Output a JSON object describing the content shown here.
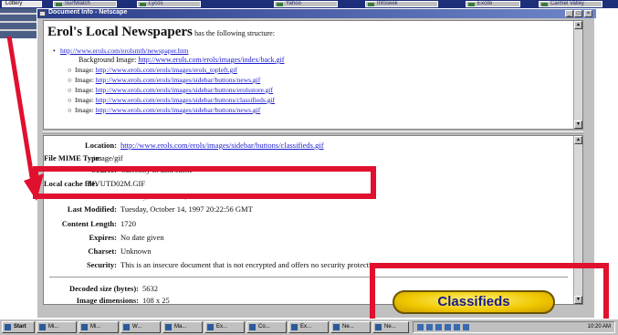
{
  "top_strip": {
    "buttons": [
      "Lottery",
      "SurfWatch",
      "Lycos",
      "Yahoo",
      "Infoseek",
      "Excite",
      "Carmel Valley"
    ]
  },
  "window": {
    "title": "Document Info - Netscape",
    "controls": [
      "_",
      "□",
      "×"
    ]
  },
  "structure": {
    "page_title": "Erol's Local Newspapers",
    "page_subtitle": "has the following structure:",
    "url_line": "http://www.erols.com/erolsmth/newspaper.htm",
    "background_label": "Background Image:",
    "background_url": "http://www.erols.com/erols/images/index/back.gif",
    "image_label": "Image:",
    "image_links": [
      "http://www.erols.com/erols/images/erols_topleft.gif",
      "http://www.erols.com/erols/images/sidebar/buttons/news.gif",
      "http://www.erols.com/erols/images/sidebar/buttons/erolsstore.gif",
      "http://www.erols.com/erols/images/sidebar/buttons/classifieds.gif",
      "http://www.erols.com/erols/images/sidebar/buttons/news.gif"
    ]
  },
  "details": {
    "location_label": "Location:",
    "location_value": "http://www.erols.com/erols/images/sidebar/buttons/classifieds.gif",
    "mime_label": "File MIME Type:",
    "mime_value": "image/gif",
    "source_label": "Source:",
    "source_value": "Currently in disk cache",
    "cache_label": "Local cache file:",
    "cache_value": "MVUTD02M.GIF",
    "lastmod_label": "Last Modified:",
    "lastmod_value": "Tuesday, October 14, 1997 20:22:56 GMT",
    "lastmod2_label": "Last Modified:",
    "lastmod2_value": "Tuesday, October 14, 1997 20:22:56 GMT",
    "length_label": "Content Length:",
    "length_value": "1720",
    "expires_label": "Expires:",
    "expires_value": "No date given",
    "charset_label": "Charset:",
    "charset_value": "Unknown",
    "security_label": "Security:",
    "security_value": "This is an insecure document that is not encrypted and offers no security protection.",
    "decoded_label": "Decoded size (bytes):",
    "decoded_value": "5632",
    "dims_label": "Image dimensions:",
    "dims_value": "108 x 25"
  },
  "classifieds_button": {
    "label": "Classifieds"
  },
  "taskbar": {
    "start": "Start",
    "items": [
      "Mi...",
      "Mi...",
      "W...",
      "Ma...",
      "Ex...",
      "Co...",
      "Ex...",
      "Ne...",
      "Ne..."
    ],
    "clock": "10:20 AM"
  },
  "colors": {
    "annotation_red": "#e0102e",
    "link_blue": "#1a1ad0",
    "titlebar_blue": "#2a3c8a",
    "button_yellow": "#f0c800"
  }
}
